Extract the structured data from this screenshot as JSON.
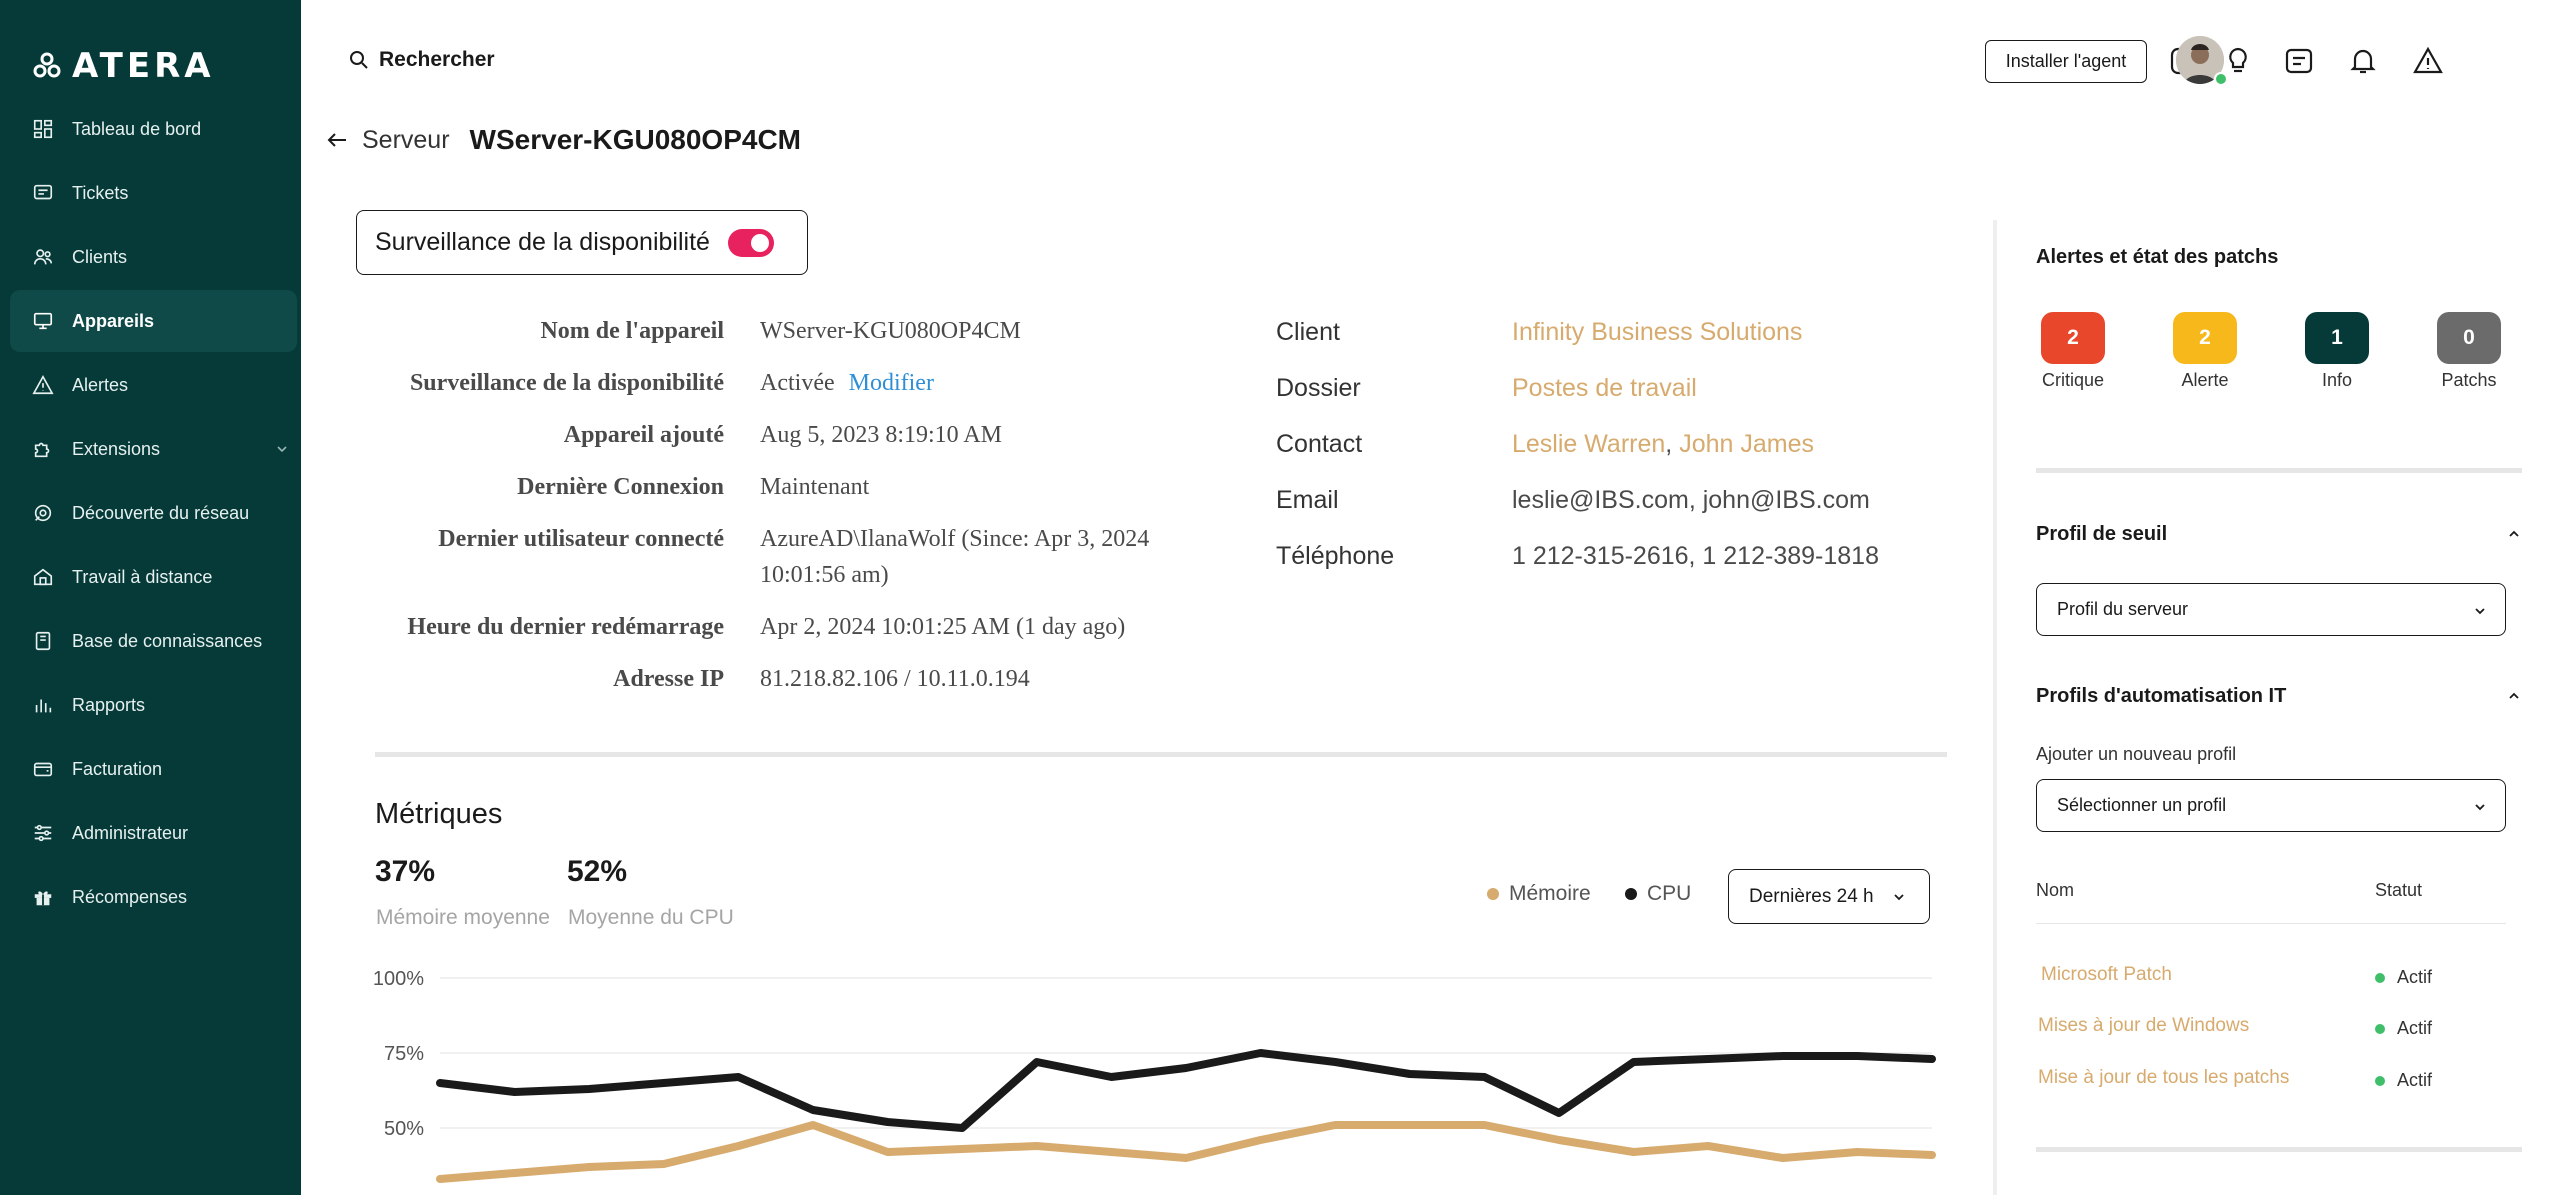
{
  "brand": {
    "name": "ATERA"
  },
  "sidebar": {
    "items": [
      {
        "label": "Tableau de bord",
        "icon": "dashboard-icon"
      },
      {
        "label": "Tickets",
        "icon": "ticket-icon"
      },
      {
        "label": "Clients",
        "icon": "clients-icon"
      },
      {
        "label": "Appareils",
        "icon": "devices-icon",
        "active": true
      },
      {
        "label": "Alertes",
        "icon": "alert-icon"
      },
      {
        "label": "Extensions",
        "icon": "extensions-icon"
      },
      {
        "label": "Découverte du réseau",
        "icon": "network-discovery-icon"
      },
      {
        "label": "Travail à distance",
        "icon": "remote-work-icon"
      },
      {
        "label": "Base de connaissances",
        "icon": "knowledge-base-icon"
      },
      {
        "label": "Rapports",
        "icon": "reports-icon"
      },
      {
        "label": "Facturation",
        "icon": "billing-icon"
      },
      {
        "label": "Administrateur",
        "icon": "admin-icon"
      },
      {
        "label": "Récompenses",
        "icon": "rewards-icon"
      }
    ]
  },
  "header": {
    "search_label": "Rechercher",
    "install_label": "Installer l'agent"
  },
  "breadcrumb": {
    "parent": "Serveur",
    "title": "WServer-KGU080OP4CM"
  },
  "availability": {
    "label": "Surveillance de la disponibilité",
    "enabled": true
  },
  "device": {
    "labels": {
      "name": "Nom de l'appareil",
      "monitoring": "Surveillance de la disponibilité",
      "added": "Appareil ajouté",
      "last_connection": "Dernière Connexion",
      "last_user": "Dernier utilisateur connecté",
      "last_reboot": "Heure du dernier redémarrage",
      "ip": "Adresse IP"
    },
    "values": {
      "name": "WServer-KGU080OP4CM",
      "monitoring": "Activée",
      "modify": "Modifier",
      "added": "Aug 5, 2023 8:19:10 AM",
      "last_connection": "Maintenant",
      "last_user_line1": "AzureAD\\IlanaWolf (Since: Apr 3, 2024",
      "last_user_line2": "10:01:56 am)",
      "last_reboot": "Apr 2, 2024 10:01:25 AM (1 day ago)",
      "ip": "81.218.82.106 / 10.11.0.194"
    }
  },
  "contact": {
    "labels": {
      "client": "Client",
      "folder": "Dossier",
      "contact": "Contact",
      "email": "Email",
      "phone": "Téléphone"
    },
    "values": {
      "client": "Infinity Business Solutions",
      "folder": "Postes de travail",
      "contact1": "Leslie Warren",
      "contact_sep": ", ",
      "contact2": "John James",
      "email": "leslie@IBS.com, john@IBS.com",
      "phone": "1 212-315-2616, 1 212-389-1818"
    }
  },
  "metrics": {
    "title": "Métriques",
    "memory_avg": "37%",
    "memory_avg_label": "Mémoire moyenne",
    "cpu_avg": "52%",
    "cpu_avg_label": "Moyenne du CPU",
    "legend_memory": "Mémoire",
    "legend_cpu": "CPU",
    "period": "Dernières 24 h"
  },
  "colors": {
    "sidebar": "#053a38",
    "accent_gold": "#d7aa6d",
    "toggle": "#e8215f",
    "critical": "#e8472c",
    "warning": "#f7b81c",
    "info": "#053a38",
    "patches": "#6b6b6b",
    "cpu_line": "#1a1a1a",
    "memory_line": "#d7aa6d"
  },
  "chart_data": {
    "type": "line",
    "yticks": [
      "100%",
      "75%",
      "50%"
    ],
    "ylim": [
      0,
      100
    ],
    "x": [
      0,
      1,
      2,
      3,
      4,
      5,
      6,
      7,
      8,
      9,
      10,
      11,
      12,
      13,
      14,
      15,
      16,
      17,
      18,
      19,
      20
    ],
    "series": [
      {
        "name": "CPU",
        "values": [
          65,
          62,
          63,
          65,
          67,
          56,
          52,
          50,
          72,
          67,
          70,
          75,
          72,
          68,
          67,
          55,
          72,
          73,
          74,
          74,
          73
        ]
      },
      {
        "name": "Mémoire",
        "values": [
          33,
          35,
          37,
          38,
          44,
          51,
          42,
          43,
          44,
          42,
          40,
          46,
          51,
          51,
          51,
          46,
          42,
          44,
          40,
          42,
          41
        ]
      }
    ]
  },
  "panel": {
    "title": "Alertes et état des patchs",
    "alerts": [
      {
        "count": "2",
        "label": "Critique"
      },
      {
        "count": "2",
        "label": "Alerte"
      },
      {
        "count": "1",
        "label": "Info"
      },
      {
        "count": "0",
        "label": "Patchs"
      }
    ],
    "threshold_title": "Profil de seuil",
    "threshold_value": "Profil du serveur",
    "automation_title": "Profils d'automatisation IT",
    "add_profile_label": "Ajouter un nouveau profil",
    "select_profile": "Sélectionner un profil",
    "col_name": "Nom",
    "col_status": "Statut",
    "profiles": [
      {
        "name": "Microsoft Patch",
        "status": "Actif"
      },
      {
        "name": "Mises à jour de Windows",
        "status": "Actif"
      },
      {
        "name": "Mise à jour de tous les patchs",
        "status": "Actif"
      }
    ]
  }
}
